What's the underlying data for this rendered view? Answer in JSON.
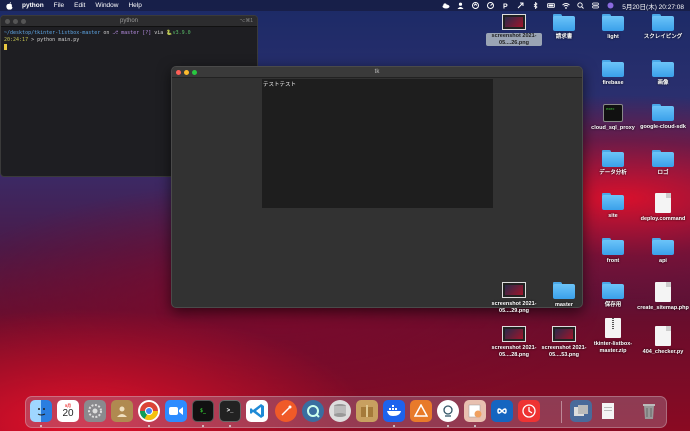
{
  "menubar": {
    "app": "python",
    "menus": [
      "File",
      "Edit",
      "Window",
      "Help"
    ],
    "clock": "5月20日(木) 20:27:08"
  },
  "terminal": {
    "title": "python",
    "shortcut": "⌥⌘1",
    "line1_path": "~/desktop/tkinter-listbox-master",
    "line1_on": " on ",
    "line1_branch": "master [?]",
    "line1_via": " via ",
    "line1_ver": "v3.9.0",
    "line2_time": "20:24:17",
    "line2_cmd": " > python main.py"
  },
  "tkwindow": {
    "title": "tk",
    "listbox_items": [
      "テストテスト"
    ]
  },
  "desktop": {
    "icons": [
      {
        "label": "screenshot 2021-05....26.png",
        "kind": "thumb"
      },
      {
        "label": "請求書",
        "kind": "folder"
      },
      {
        "label": "light",
        "kind": "folder"
      },
      {
        "label": "スクレイピング",
        "kind": "folder"
      },
      {
        "label": "firebase",
        "kind": "folder"
      },
      {
        "label": "画像",
        "kind": "folder"
      },
      {
        "label": "cloud_sql_proxy",
        "kind": "exec"
      },
      {
        "label": "google-cloud-sdk",
        "kind": "folder"
      },
      {
        "label": "データ分析",
        "kind": "folder"
      },
      {
        "label": "ロゴ",
        "kind": "folder"
      },
      {
        "label": "site",
        "kind": "folder"
      },
      {
        "label": "deploy.command",
        "kind": "doc"
      },
      {
        "label": "front",
        "kind": "folder"
      },
      {
        "label": "api",
        "kind": "folder"
      },
      {
        "label": "保存用",
        "kind": "folder"
      },
      {
        "label": "create_sitemap.php",
        "kind": "doc"
      },
      {
        "label": "screenshot 2021-05....29.png",
        "kind": "thumb"
      },
      {
        "label": "master",
        "kind": "folder"
      },
      {
        "label": "tkinter-listbox-master.zip",
        "kind": "zip"
      },
      {
        "label": "404_checker.py",
        "kind": "doc"
      },
      {
        "label": "screenshot 2021-05....28.png",
        "kind": "thumb"
      },
      {
        "label": "screenshot 2021-05....53.png",
        "kind": "thumb"
      }
    ]
  },
  "dock": {
    "calendar_month": "5月",
    "calendar_day": "20"
  },
  "colors": {
    "folder": "#4aa8e8",
    "close": "#ff5f57",
    "minimize": "#febc2e",
    "zoom": "#28c840"
  }
}
